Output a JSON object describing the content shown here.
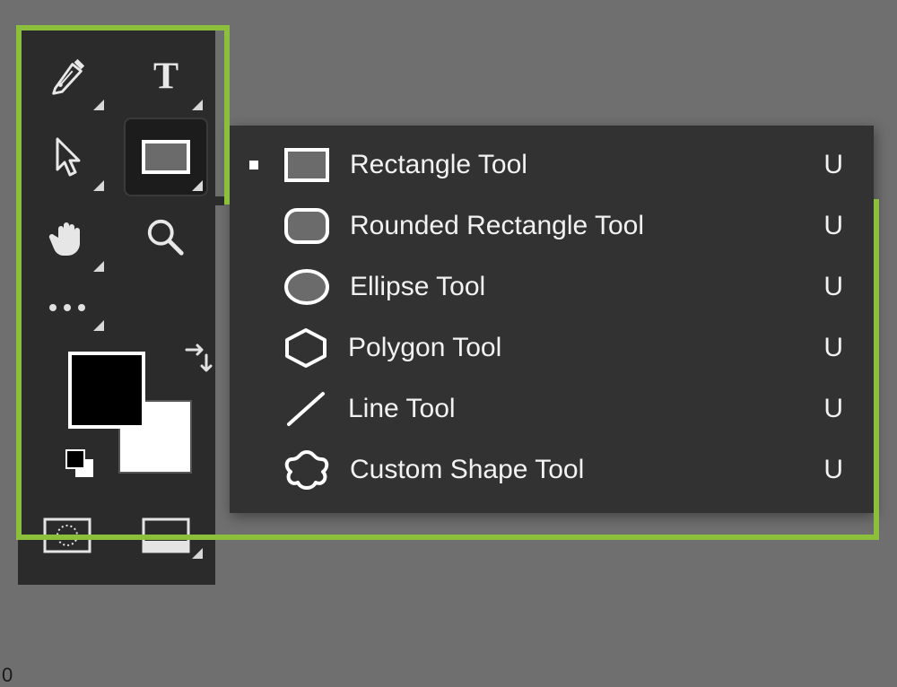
{
  "toolbar": {
    "tools": [
      {
        "name": "pen-tool"
      },
      {
        "name": "type-tool"
      },
      {
        "name": "path-select-tool"
      },
      {
        "name": "rectangle-tool",
        "selected": true
      },
      {
        "name": "hand-tool"
      },
      {
        "name": "zoom-tool"
      },
      {
        "name": "more-tools"
      }
    ],
    "zoom_label": "0"
  },
  "flyout": {
    "items": [
      {
        "label": "Rectangle Tool",
        "shortcut": "U",
        "icon": "rectangle-icon",
        "active": true
      },
      {
        "label": "Rounded Rectangle Tool",
        "shortcut": "U",
        "icon": "rounded-rectangle-icon",
        "active": false
      },
      {
        "label": "Ellipse Tool",
        "shortcut": "U",
        "icon": "ellipse-icon",
        "active": false
      },
      {
        "label": "Polygon Tool",
        "shortcut": "U",
        "icon": "hexagon-icon",
        "active": false
      },
      {
        "label": "Line Tool",
        "shortcut": "U",
        "icon": "line-icon",
        "active": false
      },
      {
        "label": "Custom Shape Tool",
        "shortcut": "U",
        "icon": "custom-shape-icon",
        "active": false
      }
    ]
  }
}
